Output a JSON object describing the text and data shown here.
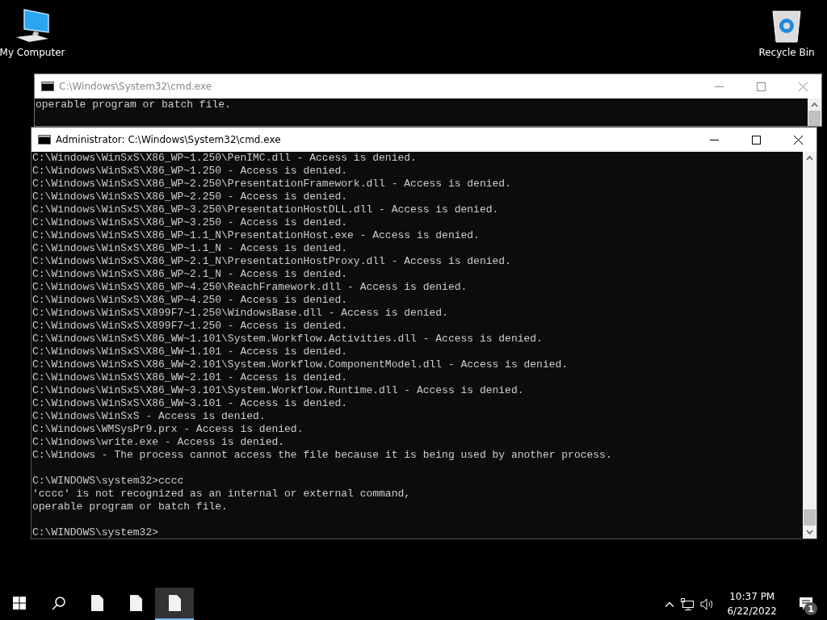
{
  "desktop_icons": [
    {
      "label": "My Computer",
      "kind": "computer"
    },
    {
      "label": "Recycle Bin",
      "kind": "bin"
    }
  ],
  "windows": [
    {
      "title": "C:\\Windows\\System32\\cmd.exe",
      "active": false,
      "blocks": [
        [
          "operable program or batch file."
        ]
      ]
    },
    {
      "title": "Administrator: C:\\Windows\\System32\\cmd.exe",
      "active": true,
      "blocks": [
        [
          "C:\\Windows\\WinSxS\\X86_WP~1.250\\PenIMC.dll - Access is denied.",
          "C:\\Windows\\WinSxS\\X86_WP~1.250 - Access is denied.",
          "C:\\Windows\\WinSxS\\X86_WP~2.250\\PresentationFramework.dll - Access is denied.",
          "C:\\Windows\\WinSxS\\X86_WP~2.250 - Access is denied.",
          "C:\\Windows\\WinSxS\\X86_WP~3.250\\PresentationHostDLL.dll - Access is denied.",
          "C:\\Windows\\WinSxS\\X86_WP~3.250 - Access is denied.",
          "C:\\Windows\\WinSxS\\X86_WP~1.1_N\\PresentationHost.exe - Access is denied.",
          "C:\\Windows\\WinSxS\\X86_WP~1.1_N - Access is denied.",
          "C:\\Windows\\WinSxS\\X86_WP~2.1_N\\PresentationHostProxy.dll - Access is denied.",
          "C:\\Windows\\WinSxS\\X86_WP~2.1_N - Access is denied.",
          "C:\\Windows\\WinSxS\\X86_WP~4.250\\ReachFramework.dll - Access is denied.",
          "C:\\Windows\\WinSxS\\X86_WP~4.250 - Access is denied.",
          "C:\\Windows\\WinSxS\\X899F7~1.250\\WindowsBase.dll - Access is denied.",
          "C:\\Windows\\WinSxS\\X899F7~1.250 - Access is denied.",
          "C:\\Windows\\WinSxS\\X86_WW~1.101\\System.Workflow.Activities.dll - Access is denied.",
          "C:\\Windows\\WinSxS\\X86_WW~1.101 - Access is denied.",
          "C:\\Windows\\WinSxS\\X86_WW~2.101\\System.Workflow.ComponentModel.dll - Access is denied.",
          "C:\\Windows\\WinSxS\\X86_WW~2.101 - Access is denied.",
          "C:\\Windows\\WinSxS\\X86_WW~3.101\\System.Workflow.Runtime.dll - Access is denied.",
          "C:\\Windows\\WinSxS\\X86_WW~3.101 - Access is denied.",
          "C:\\Windows\\WinSxS - Access is denied.",
          "C:\\Windows\\WMSysPr9.prx - Access is denied.",
          "C:\\Windows\\write.exe - Access is denied.",
          "C:\\Windows - The process cannot access the file because it is being used by another process."
        ],
        [
          "C:\\WINDOWS\\system32>cccc",
          "'cccc' is not recognized as an internal or external command,",
          "operable program or batch file."
        ],
        [
          "C:\\WINDOWS\\system32>"
        ]
      ]
    }
  ],
  "taskbar": {
    "items": [
      {
        "kind": "start",
        "selected": false
      },
      {
        "kind": "search",
        "selected": false
      },
      {
        "kind": "file",
        "selected": false
      },
      {
        "kind": "file",
        "selected": false
      },
      {
        "kind": "file",
        "selected": true
      }
    ],
    "time": "10:37 PM",
    "date": "6/22/2022",
    "notifications": "1"
  }
}
